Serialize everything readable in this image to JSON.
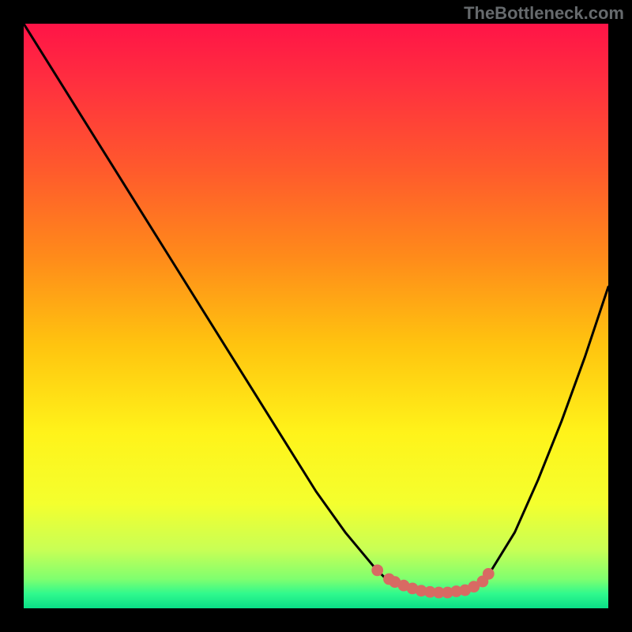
{
  "watermark": "TheBottleneck.com",
  "chart_data": {
    "type": "line",
    "title": "",
    "xlabel": "",
    "ylabel": "",
    "xlim": [
      0,
      100
    ],
    "ylim": [
      0,
      100
    ],
    "background_gradient_stops": [
      {
        "offset": 0.0,
        "color": "#ff1447"
      },
      {
        "offset": 0.1,
        "color": "#ff2f3f"
      },
      {
        "offset": 0.25,
        "color": "#ff5a2c"
      },
      {
        "offset": 0.4,
        "color": "#ff8b1a"
      },
      {
        "offset": 0.55,
        "color": "#ffc40f"
      },
      {
        "offset": 0.7,
        "color": "#fff31a"
      },
      {
        "offset": 0.82,
        "color": "#f4ff2e"
      },
      {
        "offset": 0.9,
        "color": "#c8ff55"
      },
      {
        "offset": 0.95,
        "color": "#7fff6f"
      },
      {
        "offset": 0.975,
        "color": "#30f98d"
      },
      {
        "offset": 1.0,
        "color": "#0adf87"
      }
    ],
    "series": [
      {
        "name": "bottleneck-curve",
        "color": "#000000",
        "x": [
          0,
          5,
          10,
          15,
          20,
          25,
          30,
          35,
          40,
          45,
          50,
          55,
          60,
          62,
          64,
          66,
          68,
          70,
          72,
          74,
          76,
          78,
          80,
          84,
          88,
          92,
          96,
          100
        ],
        "y": [
          100,
          92,
          84,
          76,
          68,
          60,
          52,
          44,
          36,
          28,
          20,
          13,
          7,
          5,
          4,
          3.2,
          2.8,
          2.6,
          2.6,
          2.7,
          3.1,
          4.2,
          6.5,
          13,
          22,
          32,
          43,
          55
        ]
      }
    ],
    "markers": {
      "name": "highlight-points",
      "color": "#d86a63",
      "radius_frac": 0.01,
      "points": [
        {
          "x": 60.5,
          "y": 6.5
        },
        {
          "x": 62.5,
          "y": 5.0
        },
        {
          "x": 63.5,
          "y": 4.5
        },
        {
          "x": 65.0,
          "y": 3.9
        },
        {
          "x": 66.5,
          "y": 3.4
        },
        {
          "x": 68.0,
          "y": 3.0
        },
        {
          "x": 69.5,
          "y": 2.8
        },
        {
          "x": 71.0,
          "y": 2.7
        },
        {
          "x": 72.5,
          "y": 2.7
        },
        {
          "x": 74.0,
          "y": 2.9
        },
        {
          "x": 75.5,
          "y": 3.1
        },
        {
          "x": 77.0,
          "y": 3.7
        },
        {
          "x": 78.5,
          "y": 4.6
        },
        {
          "x": 79.5,
          "y": 5.9
        }
      ]
    }
  }
}
